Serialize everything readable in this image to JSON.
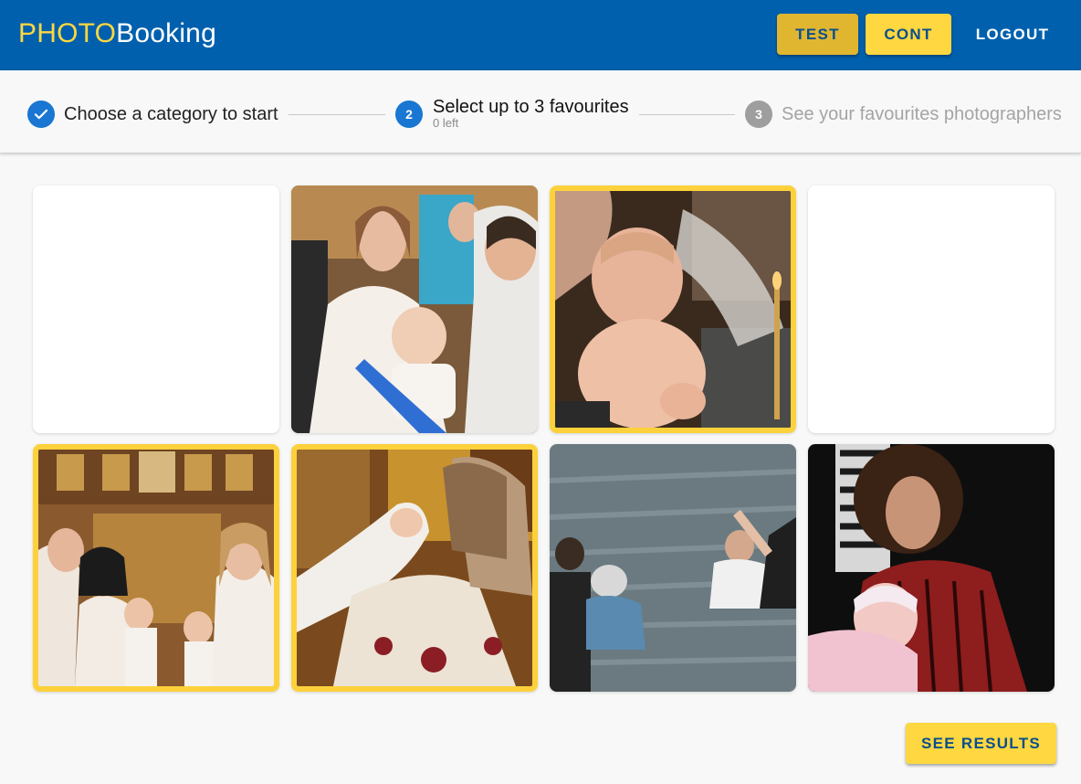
{
  "header": {
    "brand_part1": "PHOTO",
    "brand_part2": "Booking",
    "buttons": {
      "test": "TEST",
      "cont": "CONT",
      "logout": "LOGOUT"
    },
    "colors": {
      "bar": "#0160ad",
      "accent": "#ffd740"
    }
  },
  "stepper": {
    "steps": [
      {
        "number": "",
        "label": "Choose a category to start",
        "state": "completed"
      },
      {
        "number": "2",
        "label": "Select up to 3 favourites",
        "sublabel": "0 left",
        "state": "active"
      },
      {
        "number": "3",
        "label": "See your favourites photographers",
        "state": "inactive"
      }
    ]
  },
  "gallery": {
    "tiles": [
      {
        "name": "empty-tile-1",
        "selected": false,
        "content": "blank"
      },
      {
        "name": "baptism-mother-baby",
        "selected": false,
        "content": "photo"
      },
      {
        "name": "baby-water-pour",
        "selected": true,
        "content": "photo"
      },
      {
        "name": "empty-tile-2",
        "selected": false,
        "content": "blank"
      },
      {
        "name": "family-church",
        "selected": true,
        "content": "photo"
      },
      {
        "name": "priest-baby",
        "selected": true,
        "content": "photo"
      },
      {
        "name": "river-baptism",
        "selected": false,
        "content": "photo"
      },
      {
        "name": "woman-holding-baby",
        "selected": false,
        "content": "photo"
      }
    ]
  },
  "footer": {
    "see_results": "SEE RESULTS"
  }
}
